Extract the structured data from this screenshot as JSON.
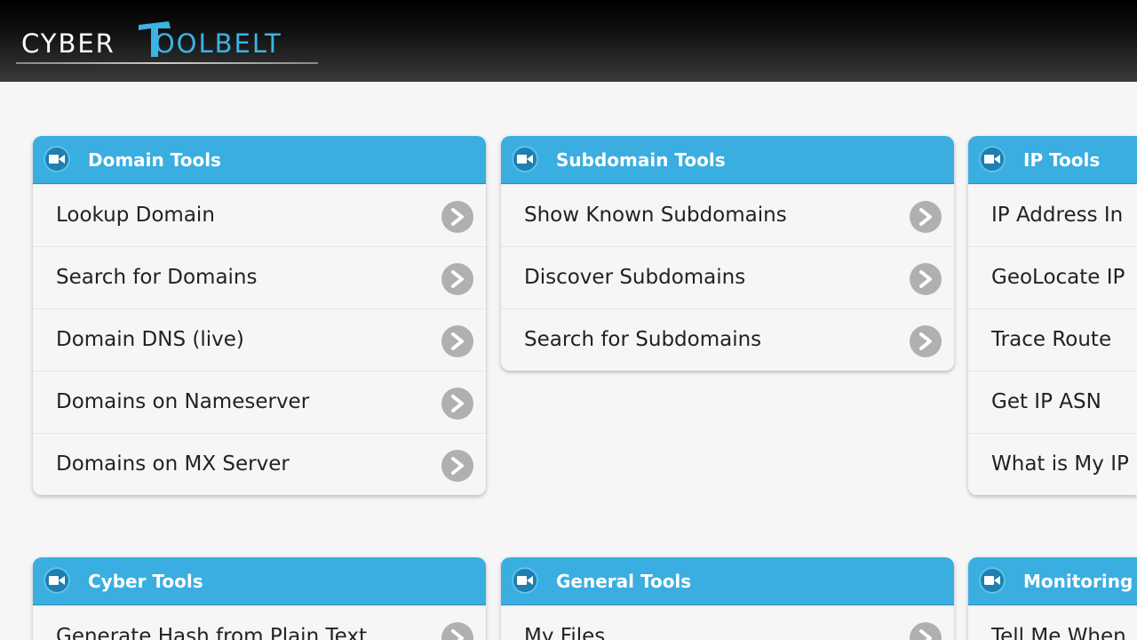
{
  "logo": {
    "part1": "CYBER",
    "part2": "OOLBELT"
  },
  "panels": [
    {
      "title": "Domain Tools",
      "items": [
        "Lookup Domain",
        "Search for Domains",
        "Domain DNS (live)",
        "Domains on Nameserver",
        "Domains on MX Server"
      ]
    },
    {
      "title": "Subdomain Tools",
      "items": [
        "Show Known Subdomains",
        "Discover Subdomains",
        "Search for Subdomains"
      ]
    },
    {
      "title": "IP Tools",
      "items": [
        "IP Address In",
        "GeoLocate IP",
        "Trace Route",
        "Get IP ASN",
        "What is My IP"
      ]
    },
    {
      "title": "Cyber Tools",
      "items": [
        "Generate Hash from Plain Text"
      ]
    },
    {
      "title": "General Tools",
      "items": [
        "My Files"
      ]
    },
    {
      "title": "Monitoring",
      "items": [
        "Tell Me When"
      ]
    }
  ],
  "colors": {
    "accent": "#3aaee0",
    "header_bg": "#000000",
    "arrow": "#b0b0b0"
  },
  "icons": {
    "panel": "video-camera-icon",
    "row": "chevron-right-circle-icon"
  }
}
